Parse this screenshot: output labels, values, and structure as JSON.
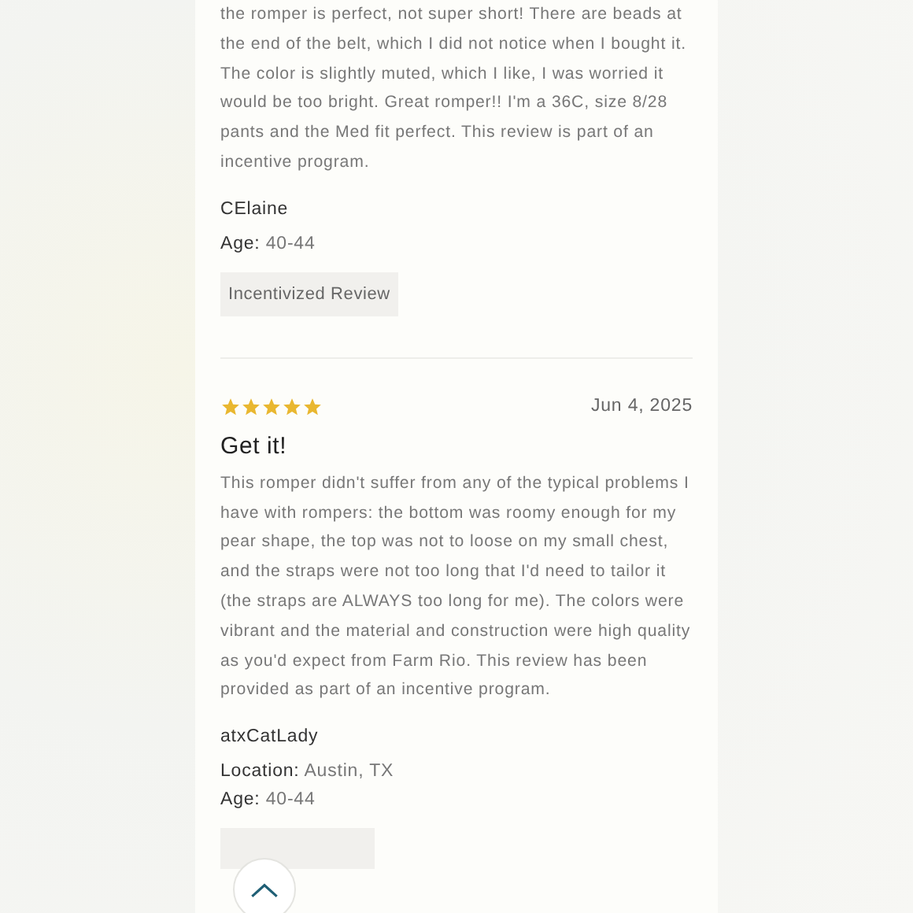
{
  "reviews": [
    {
      "kind": "continued",
      "body": "the romper is perfect, not super short! There are beads at the end of the belt, which I did not notice when I bought it. The color is slightly muted, which I like, I was worried it would be too bright. Great romper!! I'm a 36C, size 8/28 pants and the Med fit perfect. This review is part of an incentive program.",
      "author": "CElaine",
      "details": [
        {
          "label": "Age:",
          "value": "40-44"
        }
      ],
      "badge": "Incentivized Review"
    },
    {
      "kind": "full",
      "stars": 5,
      "date": "Jun 4, 2025",
      "title": "Get it!",
      "body": "This romper didn't suffer from any of the typical problems I have with rompers: the bottom was roomy enough for my pear shape, the top was not to loose on my small chest, and the straps were not too long that I'd need to tailor it (the straps are ALWAYS too long for me). The colors were vibrant and the material and construction were high quality as you'd expect from Farm Rio. This review has been provided as part of an incentive program.",
      "author": "atxCatLady",
      "details": [
        {
          "label": "Location:",
          "value": "Austin, TX"
        },
        {
          "label": "Age:",
          "value": "40-44"
        }
      ]
    }
  ]
}
